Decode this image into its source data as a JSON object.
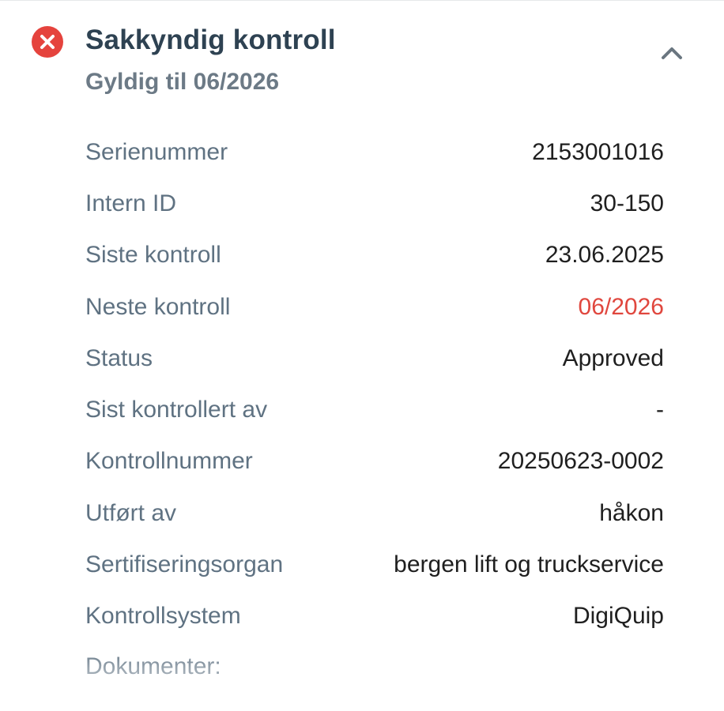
{
  "header": {
    "title": "Sakkyndig kontroll",
    "subtitle": "Gyldig til 06/2026",
    "status_icon": "error-circle-x",
    "status_color": "#e5433d",
    "collapse_icon": "chevron-up"
  },
  "details": [
    {
      "label": "Serienummer",
      "value": "2153001016"
    },
    {
      "label": "Intern ID",
      "value": "30-150"
    },
    {
      "label": "Siste kontroll",
      "value": "23.06.2025"
    },
    {
      "label": "Neste kontroll",
      "value": "06/2026"
    },
    {
      "label": "Status",
      "value": "Approved"
    },
    {
      "label": "Sist kontrollert av",
      "value": "-"
    },
    {
      "label": "Kontrollnummer",
      "value": "20250623-0002"
    },
    {
      "label": "Utført av",
      "value": "håkon"
    },
    {
      "label": "Sertifiseringsorgan",
      "value": "bergen lift og truckservice"
    },
    {
      "label": "Kontrollsystem",
      "value": "DigiQuip"
    }
  ],
  "documents": {
    "label": "Dokumenter:"
  },
  "colors": {
    "title": "#2e4252",
    "label": "#5f7282",
    "value": "#1f1f1f",
    "due": "#e0473e"
  }
}
